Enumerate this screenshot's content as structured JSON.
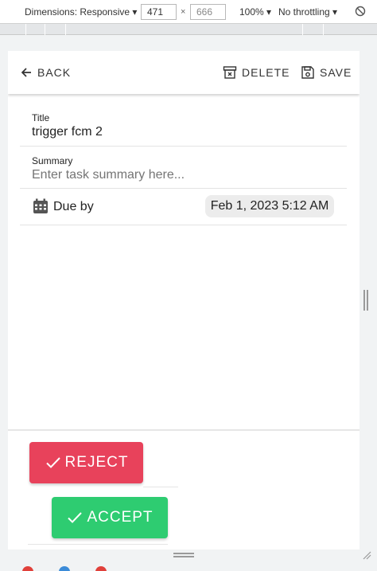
{
  "devtools": {
    "dimensions_label": "Dimensions: Responsive ▾",
    "width_value": "471",
    "times": "×",
    "height_placeholder": "666",
    "zoom": "100% ▾",
    "throttle": "No throttling ▾",
    "rotate_icon": "rotate-icon"
  },
  "appbar": {
    "back_label": "BACK",
    "delete_label": "DELETE",
    "save_label": "SAVE"
  },
  "form": {
    "title_label": "Title",
    "title_value": "trigger fcm 2",
    "summary_label": "Summary",
    "summary_placeholder": "Enter task summary here...",
    "due_label": "Due by",
    "due_value": "Feb 1, 2023 5:12 AM"
  },
  "actions": {
    "reject_label": "REJECT",
    "accept_label": "ACCEPT"
  },
  "colors": {
    "reject": "#e8425b",
    "accept": "#2ecc71",
    "chip": "#ececec"
  }
}
